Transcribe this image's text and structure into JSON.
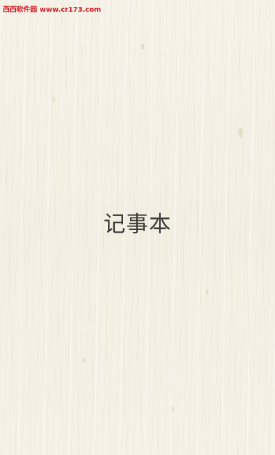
{
  "watermark": {
    "text": "西西软件园 www.cr173.com",
    "color": "#d81e28"
  },
  "splash": {
    "title": "记事本"
  },
  "colors": {
    "background": "#f5f1e6",
    "title_text": "#3a3a3a"
  }
}
